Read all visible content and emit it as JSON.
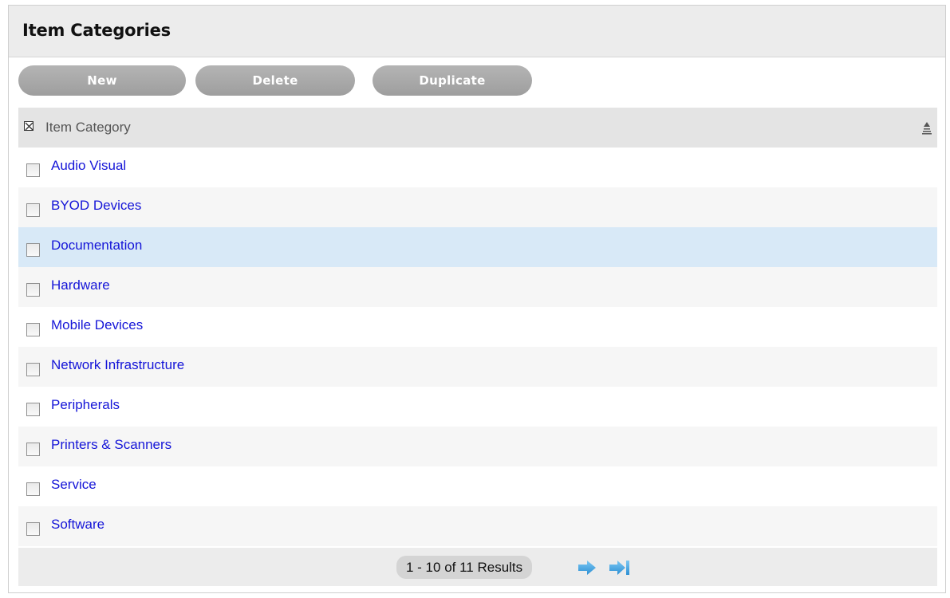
{
  "title": "Item Categories",
  "toolbar": {
    "new_label": "New",
    "delete_label": "Delete",
    "duplicate_label": "Duplicate"
  },
  "table": {
    "column_header": "Item Category",
    "selected_row_index": 2,
    "rows": [
      {
        "label": "Audio Visual"
      },
      {
        "label": "BYOD Devices"
      },
      {
        "label": "Documentation"
      },
      {
        "label": "Hardware"
      },
      {
        "label": "Mobile Devices"
      },
      {
        "label": "Network Infrastructure"
      },
      {
        "label": "Peripherals"
      },
      {
        "label": "Printers & Scanners"
      },
      {
        "label": "Service"
      },
      {
        "label": "Software"
      }
    ]
  },
  "pagination": {
    "summary": "1 - 10 of 11 Results"
  },
  "icons": {
    "header_checkbox": "select-all-checkbox-icon",
    "sort": "sort-ascending-icon",
    "next": "arrow-right-icon",
    "last": "arrow-last-icon"
  },
  "colors": {
    "link": "#1515d8",
    "button": "#a9a9a9",
    "selected_row": "#d8e9f7",
    "arrow": "#3aa0e0"
  }
}
